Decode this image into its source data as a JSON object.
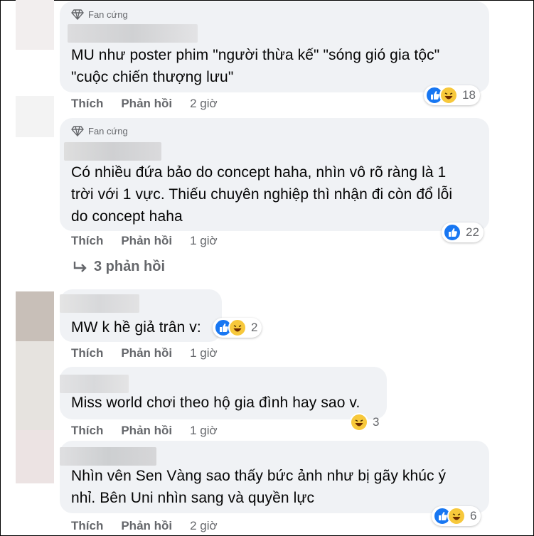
{
  "comments": [
    {
      "badge": "Fan cứng",
      "text_lines": [
        "MU như poster phim \"người thừa kế\" \"sóng gió gia tộc\"",
        "\"cuộc chiến thượng lưu\""
      ],
      "like": "Thích",
      "reply": "Phản hồi",
      "time": "2 giờ",
      "reactions": [
        "like-icon",
        "haha-icon"
      ],
      "count": "18"
    },
    {
      "badge": "Fan cứng",
      "text_lines": [
        "Có nhiều đứa bảo do concept haha, nhìn vô rõ ràng là 1",
        "trời với 1 vực. Thiếu chuyên nghiệp thì nhận đi còn đổ lỗi",
        "do concept haha"
      ],
      "like": "Thích",
      "reply": "Phản hồi",
      "time": "1 giờ",
      "reactions": [
        "like-icon"
      ],
      "count": "22",
      "replies": "3 phản hồi"
    },
    {
      "text_lines": [
        "MW k hề giả trân v:"
      ],
      "like": "Thích",
      "reply": "Phản hồi",
      "time": "1 giờ",
      "reactions": [
        "like-icon",
        "haha-icon"
      ],
      "count": "2"
    },
    {
      "text_lines": [
        "Miss world chơi theo hộ gia đình hay sao v."
      ],
      "like": "Thích",
      "reply": "Phản hồi",
      "time": "1 giờ",
      "reactions": [
        "haha-icon"
      ],
      "count": "3"
    },
    {
      "text_lines": [
        "Nhìn vên Sen Vàng sao thấy bức ảnh như bị gãy khúc ý",
        "nhỉ. Bên Uni nhìn sang và quyền lực"
      ],
      "like": "Thích",
      "reply": "Phản hồi",
      "time": "2 giờ",
      "reactions": [
        "like-icon",
        "haha-icon"
      ],
      "count": "6"
    }
  ],
  "colors": {
    "bubble": "#f0f2f5",
    "like": "#1877f2",
    "haha": "#f7c83b",
    "meta": "#65676b"
  }
}
